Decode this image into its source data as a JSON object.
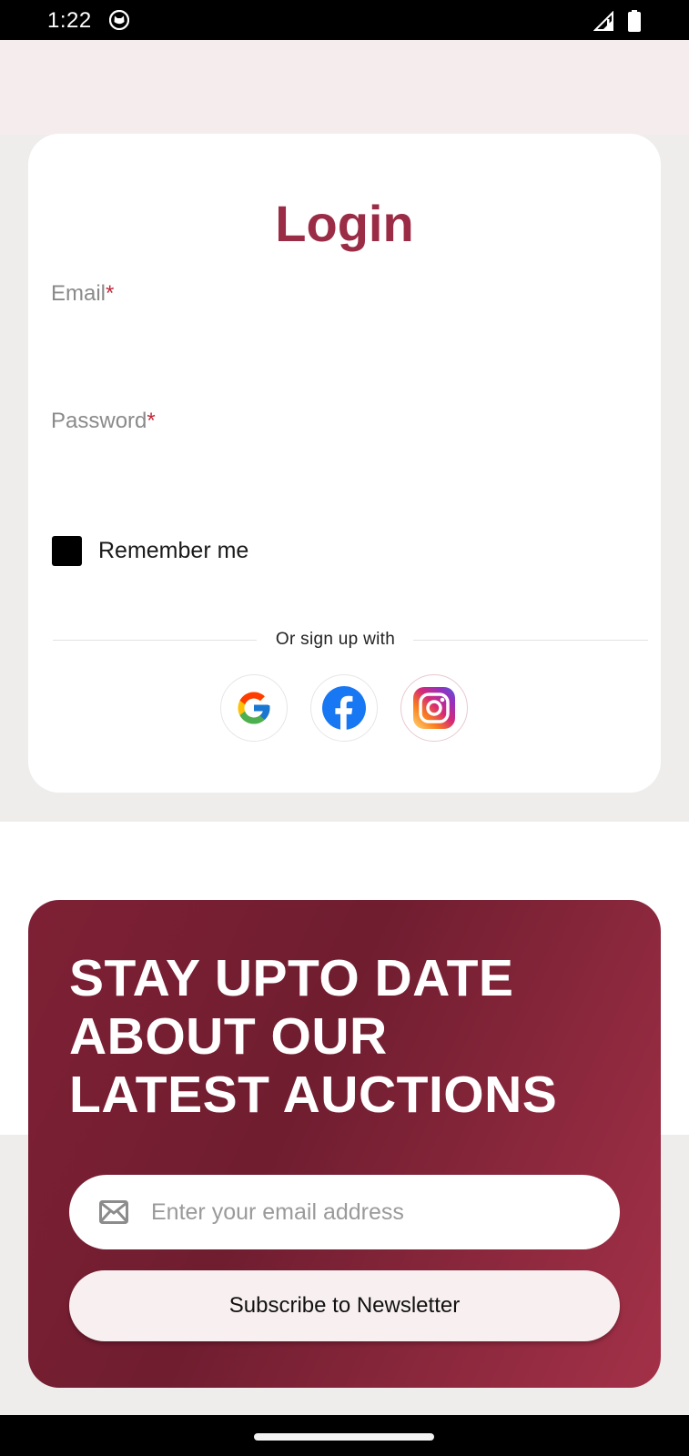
{
  "status_bar": {
    "time": "1:22"
  },
  "login": {
    "title": "Login",
    "email_label": "Email",
    "password_label": "Password",
    "required_marker": "*",
    "remember_label": "Remember me",
    "divider_text": "Or sign up with",
    "social": [
      {
        "name": "Google",
        "icon": "google-icon"
      },
      {
        "name": "Facebook",
        "icon": "facebook-icon"
      },
      {
        "name": "Instagram",
        "icon": "instagram-icon"
      }
    ]
  },
  "newsletter": {
    "heading_lines": [
      "STAY UPTO DATE",
      "ABOUT OUR",
      "LATEST AUCTIONS"
    ],
    "email_placeholder": "Enter your email address",
    "subscribe_label": "Subscribe to Newsletter"
  },
  "colors": {
    "brand": "#9b2c46",
    "required": "#c0293b",
    "newsletter_gradient_start": "#7e2035",
    "newsletter_gradient_end": "#a33148"
  }
}
